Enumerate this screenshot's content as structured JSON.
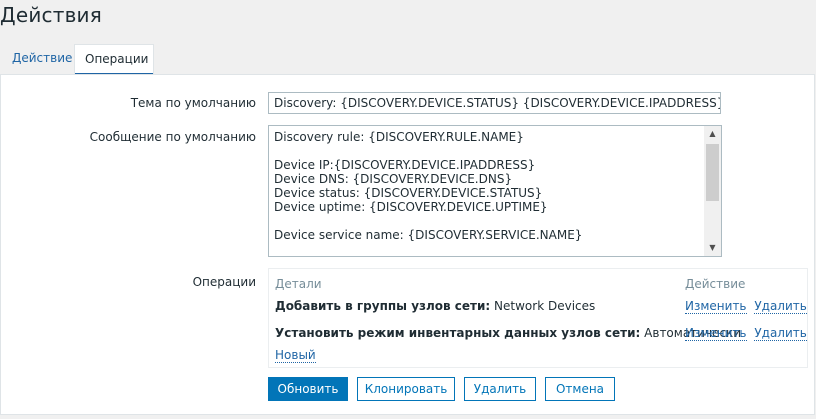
{
  "page": {
    "title": "Действия"
  },
  "tabs": [
    {
      "label": "Действие",
      "active": false
    },
    {
      "label": "Операции",
      "active": true
    }
  ],
  "form": {
    "subject_label": "Тема по умолчанию",
    "subject_value": "Discovery: {DISCOVERY.DEVICE.STATUS} {DISCOVERY.DEVICE.IPADDRESS}",
    "message_label": "Сообщение по умолчанию",
    "message_lines": [
      "Discovery rule: {DISCOVERY.RULE.NAME}",
      "",
      "Device IP:{DISCOVERY.DEVICE.IPADDRESS}",
      "Device DNS: {DISCOVERY.DEVICE.DNS}",
      "Device status: {DISCOVERY.DEVICE.STATUS}",
      "Device uptime: {DISCOVERY.DEVICE.UPTIME}",
      "",
      "Device service name: {DISCOVERY.SERVICE.NAME}"
    ],
    "operations_label": "Операции"
  },
  "operations": {
    "header_details": "Детали",
    "header_action": "Действие",
    "rows": [
      {
        "label": "Добавить в группы узлов сети:",
        "value": "Network Devices",
        "edit": "Изменить",
        "remove": "Удалить"
      },
      {
        "label": "Установить режим инвентарных данных узлов сети:",
        "value": "Автоматически",
        "edit": "Изменить",
        "remove": "Удалить"
      }
    ],
    "new_link": "Новый"
  },
  "buttons": {
    "update": "Обновить",
    "clone": "Клонировать",
    "delete": "Удалить",
    "cancel": "Отмена"
  },
  "colors": {
    "accent": "#0275b8",
    "link": "#1f65a5",
    "background": "#f0f0f0",
    "border": "#acbbc2"
  },
  "icons": {
    "scroll_up": "chevron-up-icon",
    "scroll_down": "chevron-down-icon"
  }
}
